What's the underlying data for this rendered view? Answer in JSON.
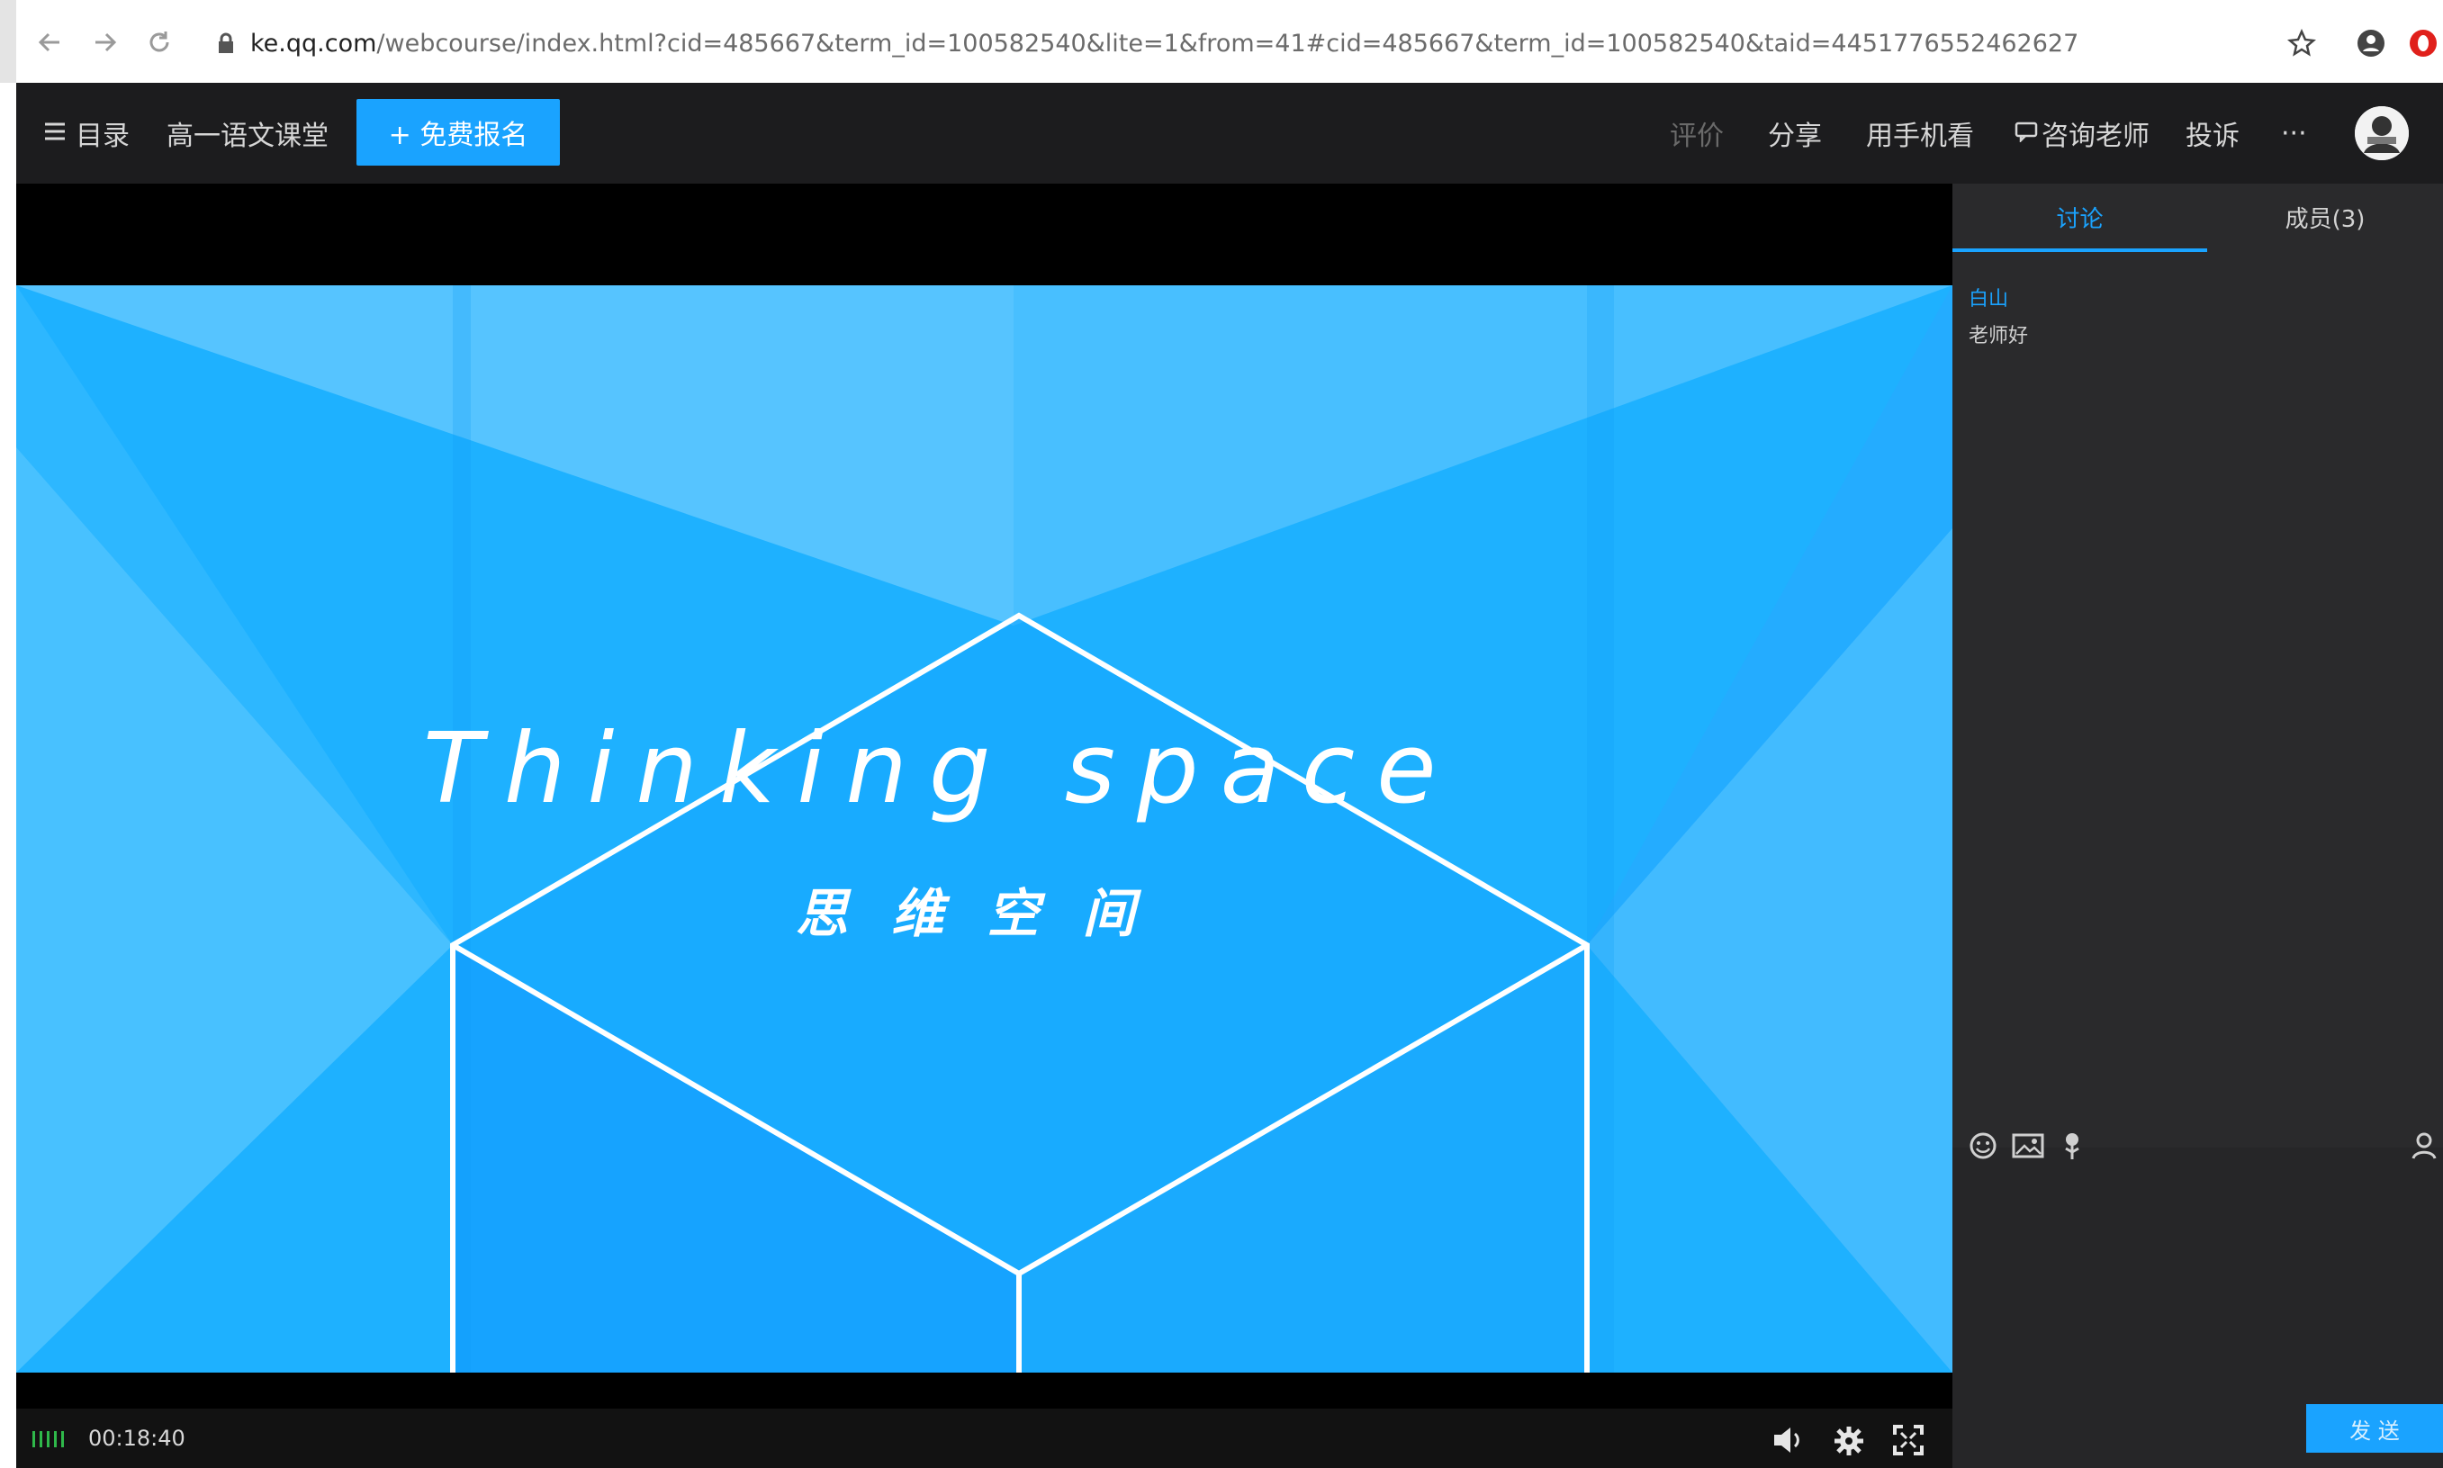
{
  "browser": {
    "url_host": "ke.qq.com",
    "url_path": "/webcourse/index.html?cid=485667&term_id=100582540&lite=1&from=41#cid=485667&term_id=100582540&taid=4451776552462627"
  },
  "topbar": {
    "menu_label": "目录",
    "course_title": "高一语文课堂",
    "signup_label": "+ 免费报名",
    "rate_label": "评价",
    "share_label": "分享",
    "mobile_label": "用手机看",
    "consult_label": "咨询老师",
    "report_label": "投诉",
    "more_label": "···"
  },
  "slide": {
    "title_en": "Thinking space",
    "title_cn": "思 维 空 间"
  },
  "player": {
    "time": "00:18:40"
  },
  "side_panel": {
    "tabs": [
      {
        "label": "讨论",
        "active": true
      },
      {
        "label": "成员(3)",
        "active": false
      }
    ],
    "messages": [
      {
        "user": "白山",
        "text": "老师好"
      }
    ],
    "send_label": "发 送"
  },
  "colors": {
    "accent": "#1aa3ff",
    "topbar_bg": "#1c1c1e",
    "panel_bg": "#2a2a2c",
    "slide_blue": "#1eb1ff"
  }
}
